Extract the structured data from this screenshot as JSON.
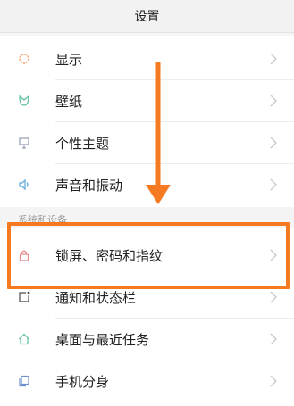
{
  "header": {
    "title": "设置"
  },
  "colors": {
    "accent": "#f57a22"
  },
  "group1": {
    "items": [
      {
        "label": "显示",
        "icon": "sun-icon"
      },
      {
        "label": "壁纸",
        "icon": "wallpaper-icon"
      },
      {
        "label": "个性主题",
        "icon": "theme-icon"
      },
      {
        "label": "声音和振动",
        "icon": "speaker-icon"
      }
    ]
  },
  "section": {
    "label": "系统和设备"
  },
  "group2": {
    "items": [
      {
        "label": "锁屏、密码和指纹",
        "icon": "lock-icon"
      },
      {
        "label": "通知和状态栏",
        "icon": "notification-icon"
      },
      {
        "label": "桌面与最近任务",
        "icon": "home-icon"
      },
      {
        "label": "手机分身",
        "icon": "clone-icon"
      }
    ]
  }
}
